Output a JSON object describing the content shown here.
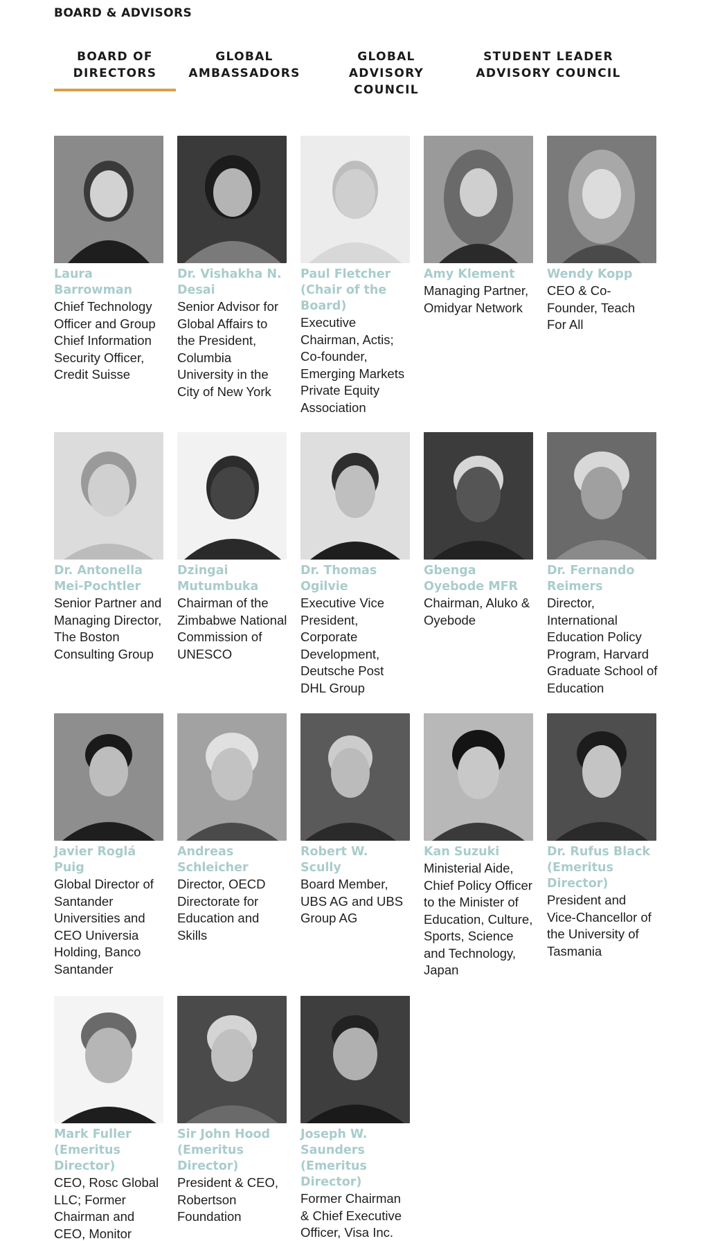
{
  "section": {
    "title": "BOARD & ADVISORS"
  },
  "tabs": [
    {
      "lines": [
        "BOARD OF",
        "DIRECTORS"
      ],
      "active": true
    },
    {
      "lines": [
        "GLOBAL",
        "AMBASSADORS"
      ],
      "active": false
    },
    {
      "lines": [
        "GLOBAL",
        "ADVISORY",
        "COUNCIL"
      ],
      "active": false
    },
    {
      "lines": [
        "STUDENT LEADER",
        "ADVISORY COUNCIL"
      ],
      "active": false
    }
  ],
  "accent_color": "#d9a04a",
  "name_color": "#a9cccc",
  "people": [
    {
      "name": "Laura Barrowman",
      "title": "Chief Technology Officer and Group Chief Information Security Officer, Credit Suisse"
    },
    {
      "name": "Dr. Vishakha N. Desai",
      "title": "Senior Advisor for Global Affairs to the President, Columbia University in the City of New York"
    },
    {
      "name": "Paul Fletcher (Chair of the Board)",
      "title": "Executive Chairman, Actis; Co-founder, Emerging Markets Private Equity Association"
    },
    {
      "name": "Amy Klement",
      "title": "Managing Partner, Omidyar Network"
    },
    {
      "name": "Wendy Kopp",
      "title": "CEO & Co-Founder, Teach For All"
    },
    {
      "name": "Dr. Antonella Mei-Pochtler",
      "title": "Senior Partner and Managing Director, The Boston Consulting Group"
    },
    {
      "name": "Dzingai Mutumbuka",
      "title": "Chairman of the Zimbabwe National Commission of UNESCO"
    },
    {
      "name": "Dr. Thomas Ogilvie",
      "title": "Executive Vice President, Corporate Development, Deutsche Post DHL Group"
    },
    {
      "name": "Gbenga Oyebode MFR",
      "title": "Chairman, Aluko & Oyebode"
    },
    {
      "name": "Dr. Fernando Reimers",
      "title": "Director, International Education Policy Program, Harvard Graduate School of Education"
    },
    {
      "name": "Javier Roglá Puig",
      "title": "Global Director of Santander Universities and CEO Universia Holding, Banco Santander"
    },
    {
      "name": "Andreas Schleicher",
      "title": "Director, OECD Directorate for Education and Skills"
    },
    {
      "name": "Robert W. Scully",
      "title": "Board Member, UBS AG and UBS Group AG"
    },
    {
      "name": "Kan Suzuki",
      "title": "Ministerial Aide, Chief Policy Officer to the Minister of Education, Culture, Sports, Science and Technology, Japan"
    },
    {
      "name": "Dr. Rufus Black (Emeritus Director)",
      "title": "President and Vice-Chancellor of the University of Tasmania"
    },
    {
      "name": "Mark Fuller (Emeritus Director)",
      "title": "CEO, Rosc Global LLC; Former Chairman and CEO, Monitor Group"
    },
    {
      "name": "Sir John Hood (Emeritus Director)",
      "title": "President & CEO, Robertson Foundation"
    },
    {
      "name": "Joseph W. Saunders (Emeritus Director)",
      "title": "Former Chairman & Chief Executive Officer, Visa Inc."
    }
  ]
}
